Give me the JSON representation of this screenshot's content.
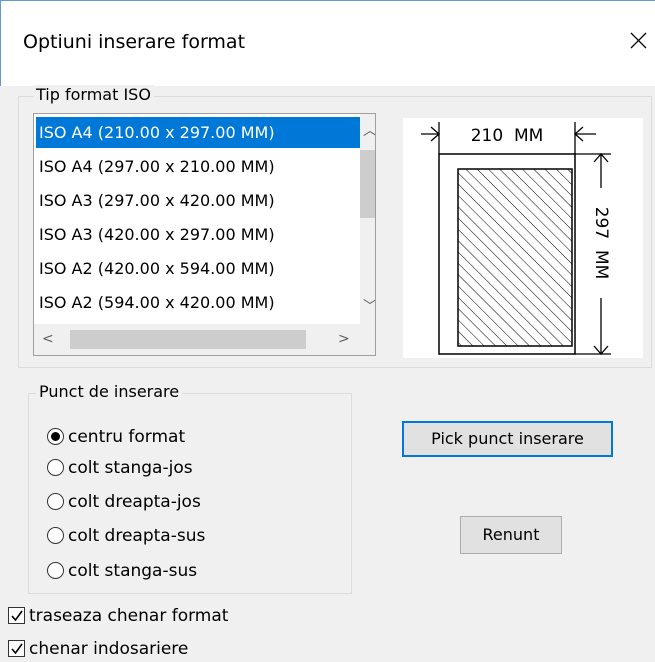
{
  "window": {
    "title": "Optiuni inserare format"
  },
  "format_group": {
    "label": "Tip format ISO",
    "items": [
      "ISO A4 (210.00 x 297.00 MM)",
      "ISO A4 (297.00 x 210.00 MM)",
      "ISO A3 (297.00 x 420.00 MM)",
      "ISO A3 (420.00 x 297.00 MM)",
      "ISO A2 (420.00 x 594.00 MM)",
      "ISO A2 (594.00 x 420.00 MM)"
    ],
    "selected_index": 0
  },
  "preview": {
    "width_label": "210  MM",
    "height_label": "297  MM"
  },
  "insert_group": {
    "label": "Punct de inserare",
    "options": [
      "centru format",
      "colt stanga-jos",
      "colt dreapta-jos",
      "colt dreapta-sus",
      "colt stanga-sus"
    ],
    "selected_index": 0
  },
  "buttons": {
    "pick_label": "Pick punct inserare",
    "cancel_label": "Renunt"
  },
  "checkboxes": [
    {
      "label": "traseaza chenar format",
      "checked": true
    },
    {
      "label": "chenar indosariere",
      "checked": true
    }
  ],
  "colors": {
    "selection": "#0078d7",
    "default_button_border": "#0078d7"
  }
}
